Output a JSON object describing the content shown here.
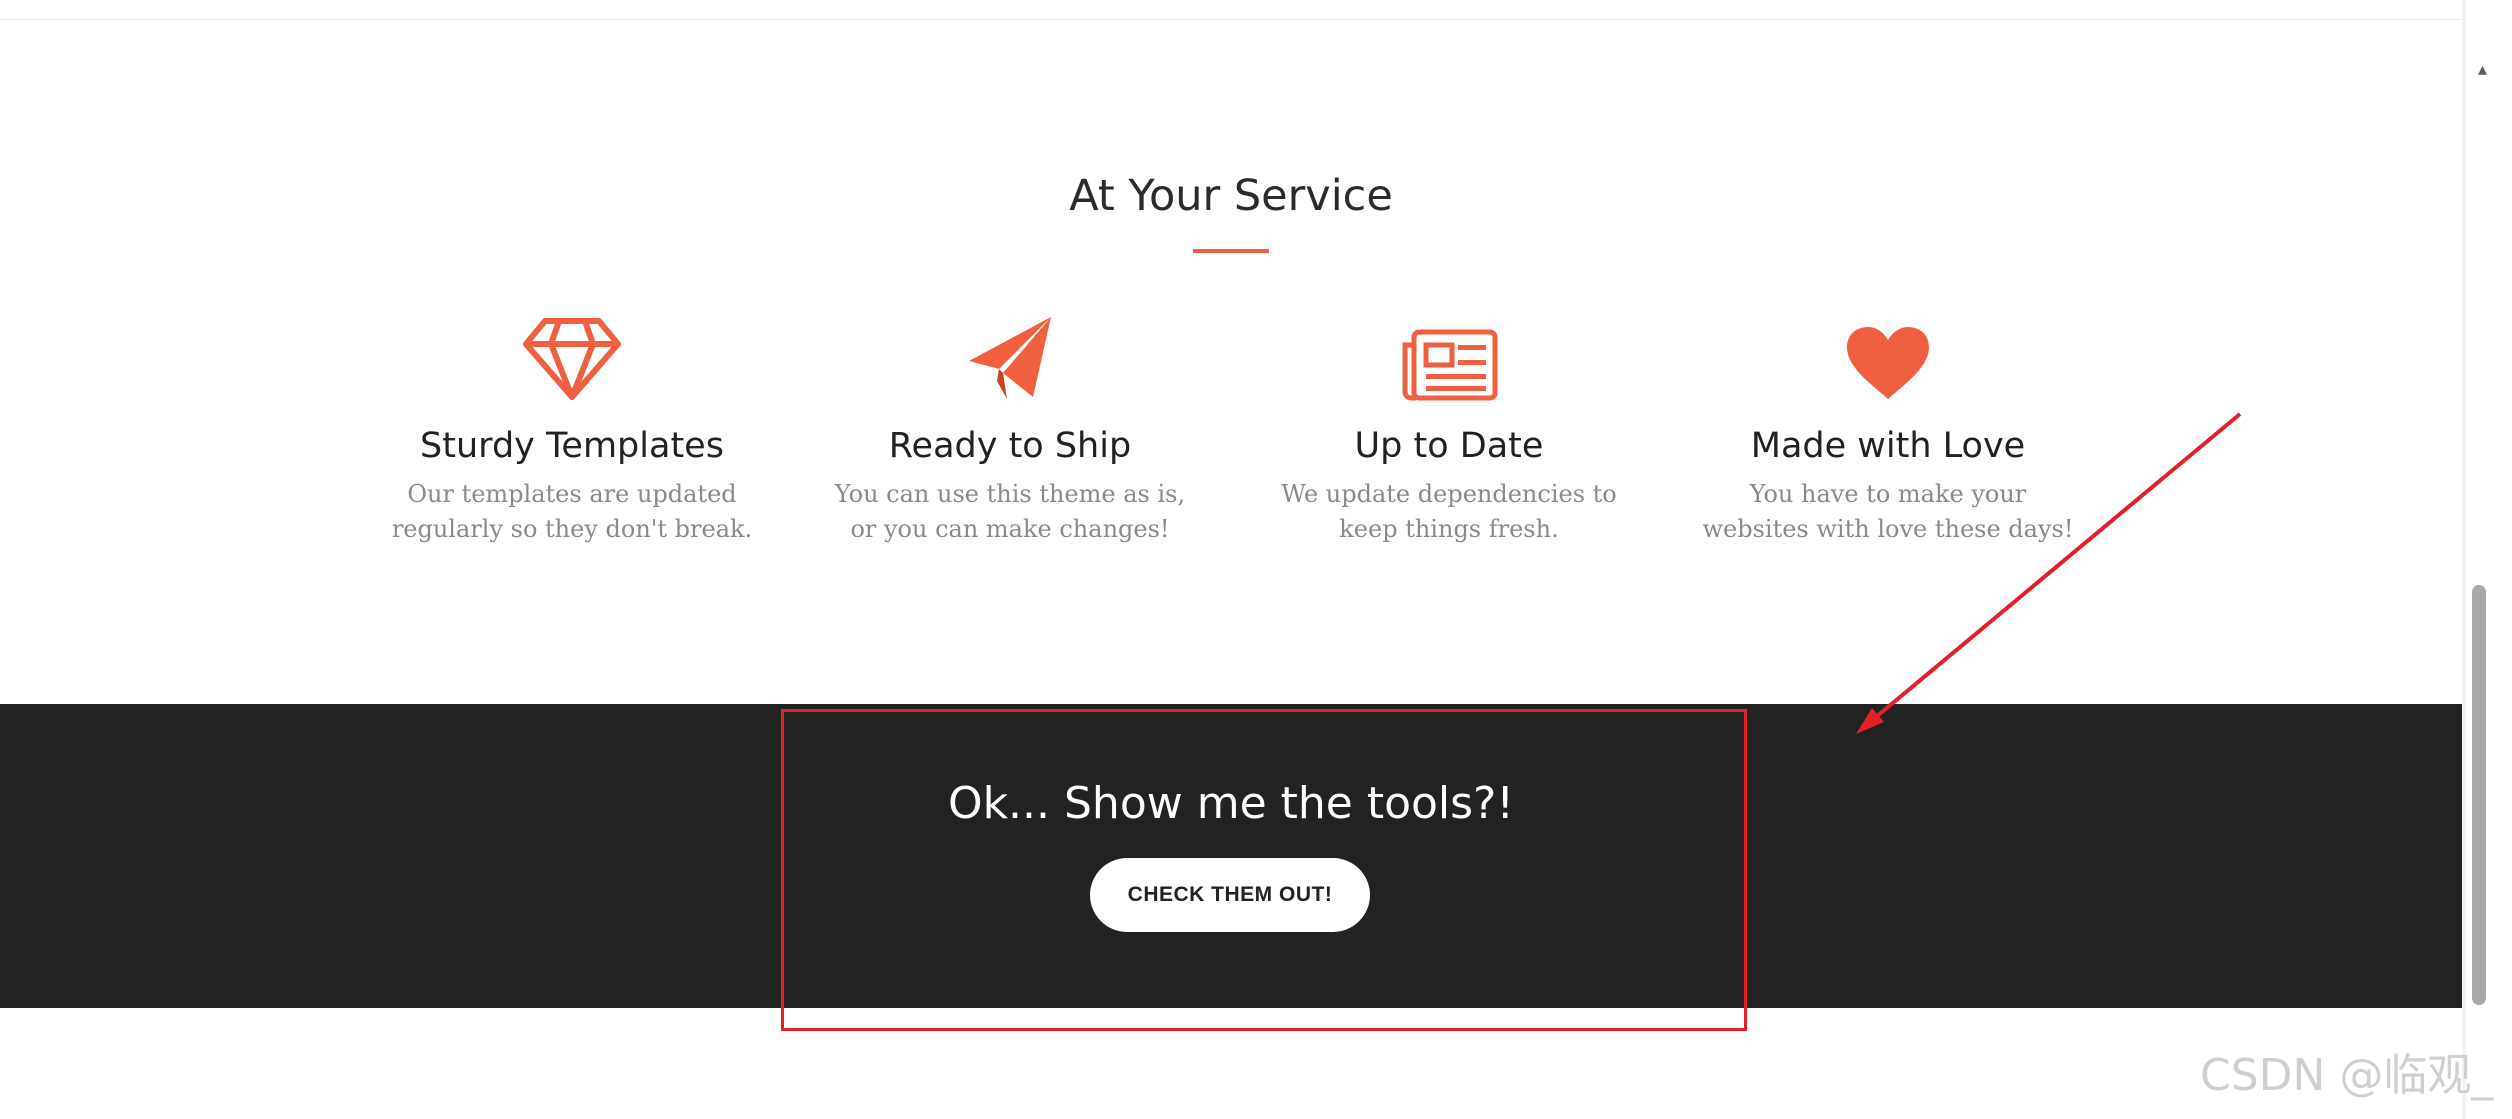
{
  "service": {
    "title": "At Your Service",
    "accent_color": "#f05f40",
    "features": [
      {
        "icon": "diamond-icon",
        "title": "Sturdy Templates",
        "description": "Our templates are updated regularly so they don't break."
      },
      {
        "icon": "paper-plane-icon",
        "title": "Ready to Ship",
        "description": "You can use this theme as is, or you can make changes!"
      },
      {
        "icon": "newspaper-icon",
        "title": "Up to Date",
        "description": "We update dependencies to keep things fresh."
      },
      {
        "icon": "heart-icon",
        "title": "Made with Love",
        "description": "You have to make your websites with love these days!"
      }
    ]
  },
  "cta": {
    "title": "Ok... Show me the tools?!",
    "button_label": "CHECK THEM OUT!",
    "background_color": "#222222"
  },
  "annotation": {
    "color": "#e3202a"
  },
  "watermark": {
    "text": "CSDN @临观_"
  }
}
